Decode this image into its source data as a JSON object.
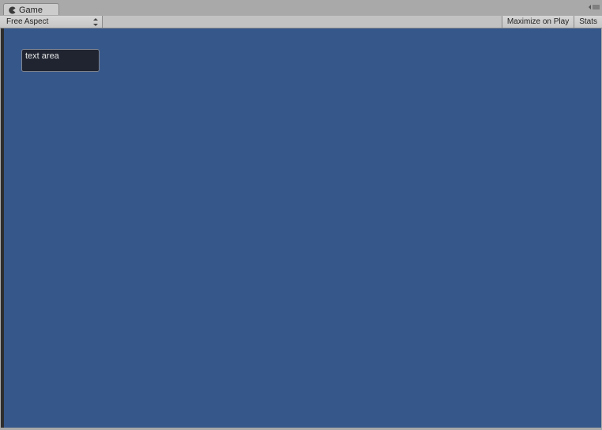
{
  "tab": {
    "icon": "pacman-icon",
    "label": "Game"
  },
  "toolbar": {
    "aspect_label": "Free Aspect",
    "maximize_label": "Maximize on Play",
    "stats_label": "Stats"
  },
  "viewport": {
    "text_area_value": "text area",
    "background_color": "#36578a"
  }
}
